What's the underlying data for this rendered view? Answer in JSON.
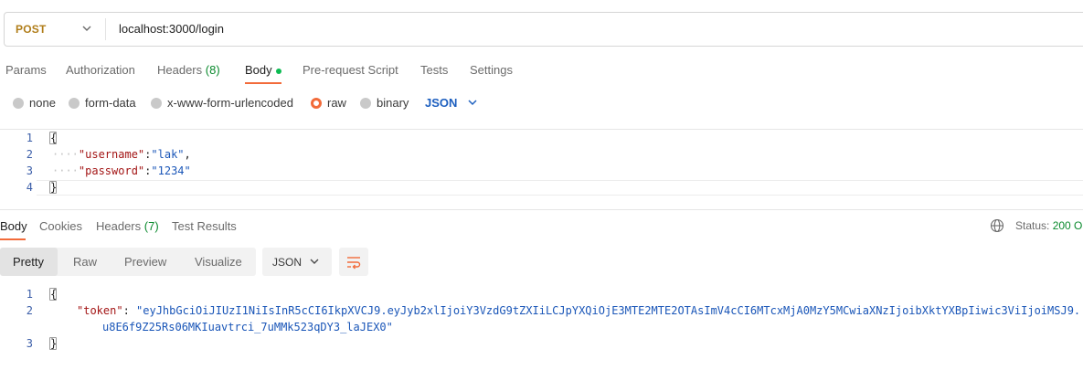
{
  "request": {
    "method": "POST",
    "url": "localhost:3000/login",
    "tabs": [
      {
        "label": "Params"
      },
      {
        "label": "Authorization"
      },
      {
        "label": "Headers",
        "count": "(8)"
      },
      {
        "label": "Body"
      },
      {
        "label": "Pre-request Script"
      },
      {
        "label": "Tests"
      },
      {
        "label": "Settings"
      }
    ],
    "body_types": [
      {
        "label": "none"
      },
      {
        "label": "form-data"
      },
      {
        "label": "x-www-form-urlencoded"
      },
      {
        "label": "raw"
      },
      {
        "label": "binary"
      }
    ],
    "body_format": "JSON",
    "line_numbers": [
      "1",
      "2",
      "3",
      "4"
    ],
    "body_lines": {
      "open": "{",
      "username_key": "\"username\"",
      "username_value": "\"lak\"",
      "password_key": "\"password\"",
      "password_value": "\"1234\"",
      "close": "}"
    }
  },
  "response": {
    "tabs": [
      {
        "label": "Body"
      },
      {
        "label": "Cookies"
      },
      {
        "label": "Headers",
        "count": "(7)"
      },
      {
        "label": "Test Results"
      }
    ],
    "status_label": "Status:",
    "status_value": "200 O",
    "views": [
      "Pretty",
      "Raw",
      "Preview",
      "Visualize"
    ],
    "format": "JSON",
    "line_numbers": [
      "1",
      "2",
      "3"
    ],
    "token_key": "\"token\"",
    "token_line1": "\"eyJhbGciOiJIUzI1NiIsInR5cCI6IkpXVCJ9.eyJyb2xlIjoiY3VzdG9tZXIiLCJpYXQiOjE3MTE2MTE2OTAsImV4cCI6MTcxMjA0MzY5MCwiaXNzIjoibXktYXBpIiwic3ViIjoiMSJ9.",
    "token_line2": "u8E6f9Z25Rs06MKIuavtrci_7uMMk523qDY3_laJEX0\"",
    "open": "{",
    "close": "}"
  },
  "colors": {
    "accent": "#f26b3a",
    "method": "#b07d19",
    "count_green": "#0b8a2e",
    "json_key": "#a31515",
    "json_string": "#1a56b8"
  }
}
